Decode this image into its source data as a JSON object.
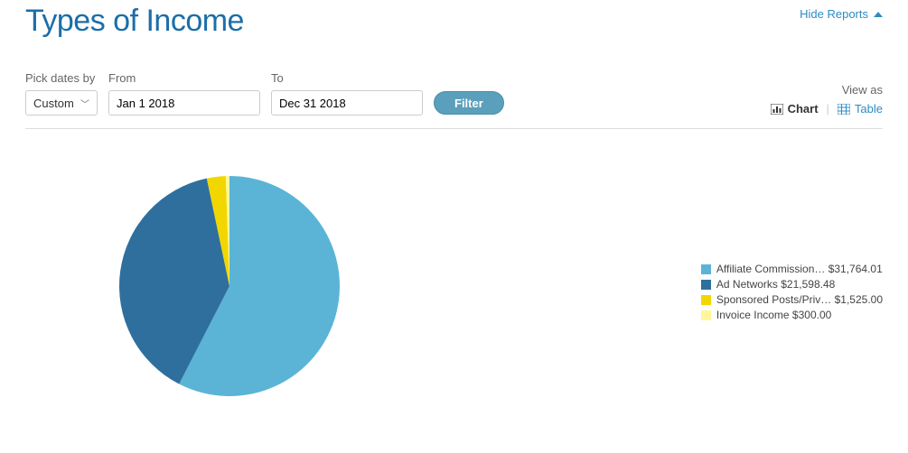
{
  "header": {
    "title": "Types of Income",
    "hide_reports": "Hide Reports"
  },
  "filters": {
    "pick_label": "Pick dates by",
    "pick_value": "Custom",
    "from_label": "From",
    "from_value": "Jan 1 2018",
    "to_label": "To",
    "to_value": "Dec 31 2018",
    "button": "Filter"
  },
  "viewas": {
    "label": "View as",
    "chart": "Chart",
    "table": "Table"
  },
  "legend": [
    {
      "label": "Affiliate Commission…",
      "amount": "$31,764.01",
      "color": "#5bb4d6"
    },
    {
      "label": "Ad Networks",
      "amount": "$21,598.48",
      "color": "#2f6f9e"
    },
    {
      "label": "Sponsored Posts/Priv…",
      "amount": "$1,525.00",
      "color": "#f2d600"
    },
    {
      "label": "Invoice Income",
      "amount": "$300.00",
      "color": "#fff79a"
    }
  ],
  "chart_data": {
    "type": "pie",
    "title": "Types of Income",
    "series": [
      {
        "name": "Affiliate Commissions",
        "value": 31764.01,
        "color": "#5bb4d6"
      },
      {
        "name": "Ad Networks",
        "value": 21598.48,
        "color": "#2f6f9e"
      },
      {
        "name": "Sponsored Posts/Private Ads",
        "value": 1525.0,
        "color": "#f2d600"
      },
      {
        "name": "Invoice Income",
        "value": 300.0,
        "color": "#fff79a"
      }
    ]
  }
}
